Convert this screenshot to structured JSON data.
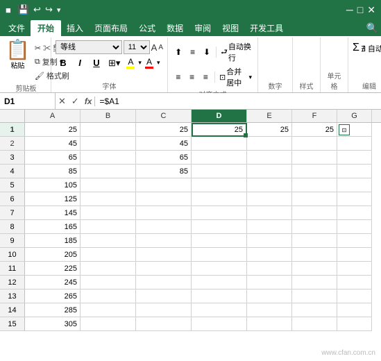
{
  "titleBar": {
    "icons": [
      "💾",
      "↩",
      "↪"
    ]
  },
  "ribbonTabs": [
    {
      "label": "文件",
      "active": false
    },
    {
      "label": "开始",
      "active": true
    },
    {
      "label": "插入",
      "active": false
    },
    {
      "label": "页面布局",
      "active": false
    },
    {
      "label": "公式",
      "active": false
    },
    {
      "label": "数据",
      "active": false
    },
    {
      "label": "审阅",
      "active": false
    },
    {
      "label": "视图",
      "active": false
    },
    {
      "label": "开发工具",
      "active": false
    }
  ],
  "clipboard": {
    "paste_label": "粘贴",
    "cut_label": "✂ 剪切",
    "copy_label": "复制 ▾",
    "format_label": "格式刷",
    "group_label": "剪贴板"
  },
  "font": {
    "name": "等线",
    "size": "11",
    "bold": "B",
    "italic": "I",
    "underline": "U",
    "border_icon": "⊞",
    "fill_icon": "A",
    "font_icon": "A",
    "group_label": "字体"
  },
  "alignment": {
    "group_label": "对齐方式",
    "auto_wrap": "自动换行",
    "merge": "合并居中",
    "merge_dropdown": "▾"
  },
  "formulaBar": {
    "cellRef": "D1",
    "formula": "=$A1",
    "cancel_icon": "✕",
    "confirm_icon": "✓",
    "fx_label": "fx"
  },
  "columns": [
    "A",
    "B",
    "C",
    "D",
    "E",
    "F",
    "G"
  ],
  "activeCol": "D",
  "activeRow": 1,
  "rows": [
    {
      "row": 1,
      "A": "25",
      "B": "",
      "C": "25",
      "D": "25",
      "E": "25",
      "F": "25",
      "G": ""
    },
    {
      "row": 2,
      "A": "45",
      "B": "",
      "C": "45",
      "D": "",
      "E": "",
      "F": "",
      "G": ""
    },
    {
      "row": 3,
      "A": "65",
      "B": "",
      "C": "65",
      "D": "",
      "E": "",
      "F": "",
      "G": ""
    },
    {
      "row": 4,
      "A": "85",
      "B": "",
      "C": "85",
      "D": "",
      "E": "",
      "F": "",
      "G": ""
    },
    {
      "row": 5,
      "A": "105",
      "B": "",
      "C": "",
      "D": "",
      "E": "",
      "F": "",
      "G": ""
    },
    {
      "row": 6,
      "A": "125",
      "B": "",
      "C": "",
      "D": "",
      "E": "",
      "F": "",
      "G": ""
    },
    {
      "row": 7,
      "A": "145",
      "B": "",
      "C": "",
      "D": "",
      "E": "",
      "F": "",
      "G": ""
    },
    {
      "row": 8,
      "A": "165",
      "B": "",
      "C": "",
      "D": "",
      "E": "",
      "F": "",
      "G": ""
    },
    {
      "row": 9,
      "A": "185",
      "B": "",
      "C": "",
      "D": "",
      "E": "",
      "F": "",
      "G": ""
    },
    {
      "row": 10,
      "A": "205",
      "B": "",
      "C": "",
      "D": "",
      "E": "",
      "F": "",
      "G": ""
    },
    {
      "row": 11,
      "A": "225",
      "B": "",
      "C": "",
      "D": "",
      "E": "",
      "F": "",
      "G": ""
    },
    {
      "row": 12,
      "A": "245",
      "B": "",
      "C": "",
      "D": "",
      "E": "",
      "F": "",
      "G": ""
    },
    {
      "row": 13,
      "A": "265",
      "B": "",
      "C": "",
      "D": "",
      "E": "",
      "F": "",
      "G": ""
    },
    {
      "row": 14,
      "A": "285",
      "B": "",
      "C": "",
      "D": "",
      "E": "",
      "F": "",
      "G": ""
    },
    {
      "row": 15,
      "A": "305",
      "B": "",
      "C": "",
      "D": "",
      "E": "",
      "F": "",
      "G": ""
    }
  ],
  "watermark": "www.cfan.com.cn"
}
